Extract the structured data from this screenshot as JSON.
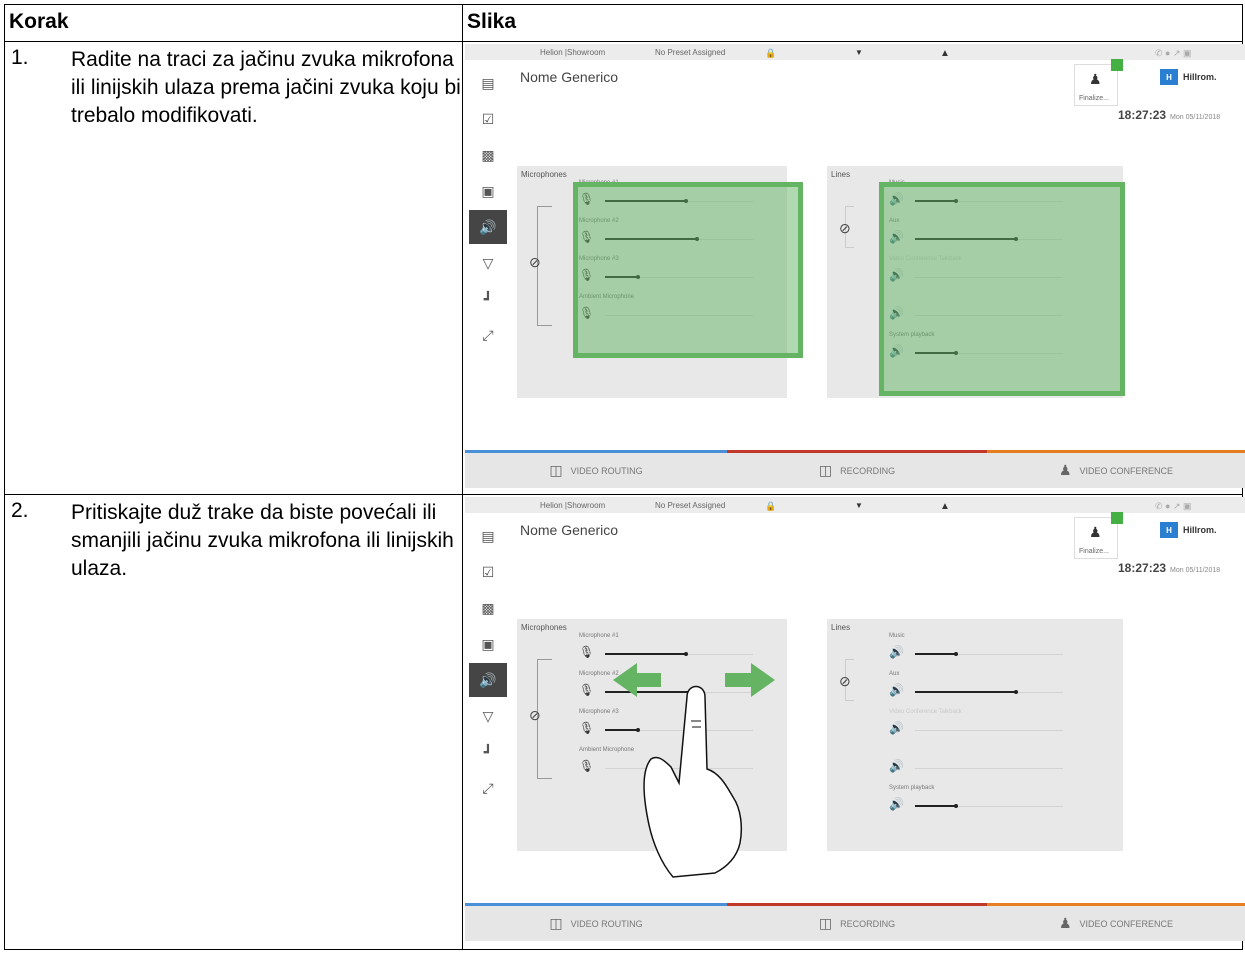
{
  "table": {
    "header": {
      "step": "Korak",
      "image": "Slika"
    },
    "rows": [
      {
        "number": "1.",
        "text": "Radite na traci za jačinu zvuka mikrofona ili linijskih ulaza prema jačini zvuka koju bi trebalo modifikovati."
      },
      {
        "number": "2.",
        "text": "Pritiskajte duž trake da biste povećali ili smanjili jačinu zvuka mikrofona ili linijskih ulaza."
      }
    ]
  },
  "screen": {
    "topbar": {
      "room": "Helion |Showroom",
      "preset": "No Preset Assigned"
    },
    "patient_name": "Nome Generico",
    "finalize_label": "Finalize...",
    "brand": "Hillrom.",
    "brand_mark": "H",
    "time": "18:27:23",
    "date": "Mon 05/11/2018",
    "microphones": {
      "title": "Microphones",
      "channels": [
        {
          "label": "Microphone #1",
          "level": 0.55
        },
        {
          "label": "Microphone #2",
          "level": 0.62
        },
        {
          "label": "Microphone #3",
          "level": 0.22
        },
        {
          "label": "Ambient Microphone",
          "level": 0
        }
      ]
    },
    "lines": {
      "title": "Lines",
      "channels": [
        {
          "label": "Music",
          "level": 0.28,
          "active": true
        },
        {
          "label": "Aux",
          "level": 0.68,
          "active": true
        },
        {
          "label": "Video Conference Talkback",
          "level": 0,
          "active": false
        },
        {
          "label": "",
          "level": 0,
          "active": false
        },
        {
          "label": "System playback",
          "level": 0.28,
          "active": true
        }
      ]
    },
    "bottom_tabs": [
      {
        "label": "VIDEO ROUTING",
        "color": "#4a90d9"
      },
      {
        "label": "RECORDING",
        "color": "#c0392b"
      },
      {
        "label": "VIDEO CONFERENCE",
        "color": "#e67e22"
      }
    ],
    "highlight_color": "#64b464"
  }
}
